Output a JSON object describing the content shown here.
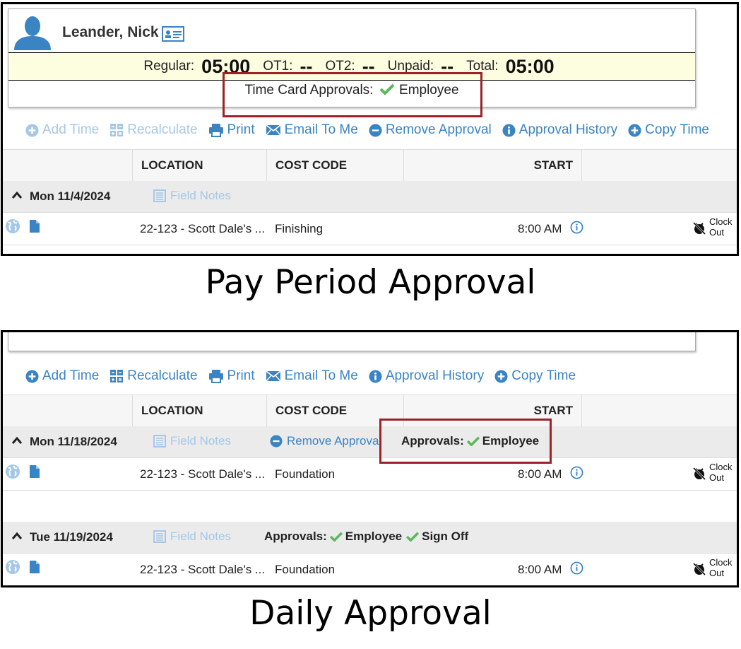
{
  "employee": {
    "name": "Leander, Nick"
  },
  "hours": [
    {
      "label": "Regular:",
      "value": "05:00"
    },
    {
      "label": "OT1:",
      "value": "--"
    },
    {
      "label": "OT2:",
      "value": "--"
    },
    {
      "label": "Unpaid:",
      "value": "--"
    },
    {
      "label": "Total:",
      "value": "05:00"
    }
  ],
  "timecard_approvals": {
    "label": "Time Card Approvals:",
    "value": "Employee"
  },
  "toolbar1": {
    "add_time": "Add Time",
    "recalculate": "Recalculate",
    "print": "Print",
    "email": "Email To Me",
    "remove_approval": "Remove Approval",
    "approval_history": "Approval History",
    "copy_time": "Copy Time"
  },
  "toolbar2": {
    "add_time": "Add Time",
    "recalculate": "Recalculate",
    "print": "Print",
    "email": "Email To Me",
    "approval_history": "Approval History",
    "copy_time": "Copy Time"
  },
  "columns": {
    "location": "LOCATION",
    "cost_code": "COST CODE",
    "start": "START"
  },
  "field_notes": "Field Notes",
  "remove_approval": "Remove Approval",
  "approvals_label": "Approvals:",
  "approver_employee": "Employee",
  "approver_signoff": "Sign Off",
  "clock_out": {
    "line1": "Clock",
    "line2": "Out"
  },
  "days": [
    {
      "date": "Mon 11/4/2024",
      "entry": {
        "location": "22-123 - Scott Dale's ...",
        "cost_code": "Finishing",
        "start": "8:00 AM"
      }
    },
    {
      "date": "Mon 11/18/2024",
      "entry": {
        "location": "22-123 - Scott Dale's ...",
        "cost_code": "Foundation",
        "start": "8:00 AM"
      }
    },
    {
      "date": "Tue 11/19/2024",
      "entry": {
        "location": "22-123 - Scott Dale's ...",
        "cost_code": "Foundation",
        "start": "8:00 AM"
      }
    }
  ],
  "captions": {
    "pay_period": "Pay Period Approval",
    "daily": "Daily Approval"
  },
  "colors": {
    "link": "#3a84c4",
    "link_disabled": "#a6c8e6",
    "check": "#5cb85c",
    "highlight_box": "#9b2327",
    "hours_bg": "#fdfde0"
  }
}
